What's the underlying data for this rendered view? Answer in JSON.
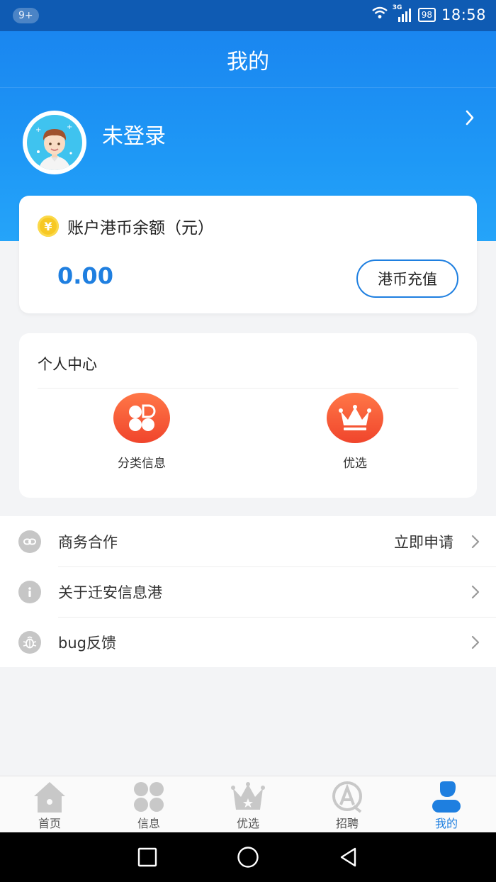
{
  "status_bar": {
    "notification_count": "9+",
    "network": "3G",
    "battery": "98",
    "time": "18:58"
  },
  "header": {
    "title": "我的"
  },
  "profile": {
    "login_status": "未登录"
  },
  "balance": {
    "label": "账户港币余额（元）",
    "coin_symbol": "¥",
    "amount": "0.00",
    "recharge_label": "港币充值"
  },
  "center": {
    "title": "个人中心",
    "items": [
      {
        "label": "分类信息",
        "icon": "clover-icon"
      },
      {
        "label": "优选",
        "icon": "crown-icon"
      }
    ]
  },
  "menu": [
    {
      "label": "商务合作",
      "value": "立即申请",
      "icon": "link-icon"
    },
    {
      "label": "关于迁安信息港",
      "value": "",
      "icon": "info-icon"
    },
    {
      "label": "bug反馈",
      "value": "",
      "icon": "bug-icon"
    }
  ],
  "tabs": [
    {
      "label": "首页",
      "icon": "home-icon"
    },
    {
      "label": "信息",
      "icon": "grid-icon"
    },
    {
      "label": "优选",
      "icon": "crown-icon"
    },
    {
      "label": "招聘",
      "icon": "recruit-icon"
    },
    {
      "label": "我的",
      "icon": "profile-icon",
      "active": true
    }
  ],
  "colors": {
    "primary": "#1e7fe0",
    "accent": "#f0452c",
    "coin": "#f7c824"
  }
}
